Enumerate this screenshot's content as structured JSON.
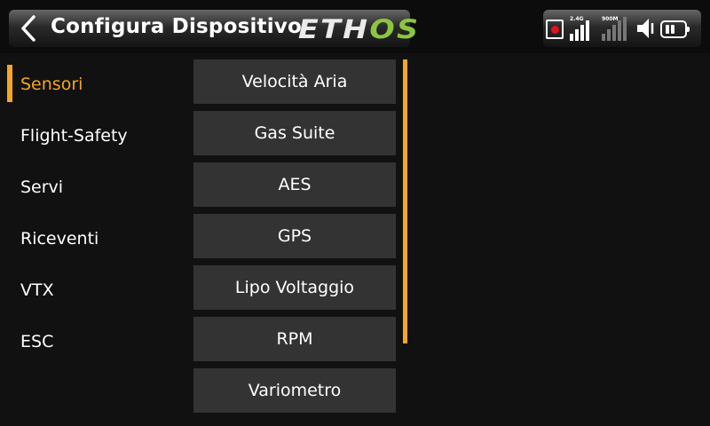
{
  "header": {
    "title": "Configura Dispositivo",
    "logo_main": "ETH",
    "logo_accent": "OS",
    "logo_accent_color": "#8cc63f",
    "back_icon": "chevron-left-icon"
  },
  "status": {
    "band_1_label": "2.4G",
    "band_2_label": "900M",
    "record_icon": "record-icon",
    "speaker_icon": "speaker-icon",
    "battery_icon": "battery-icon"
  },
  "sidebar": {
    "accent_color": "#f5a623",
    "items": [
      {
        "label": "Sensori",
        "active": true
      },
      {
        "label": "Flight-Safety",
        "active": false
      },
      {
        "label": "Servi",
        "active": false
      },
      {
        "label": "Riceventi",
        "active": false
      },
      {
        "label": "VTX",
        "active": false
      },
      {
        "label": "ESC",
        "active": false
      }
    ]
  },
  "options": {
    "items": [
      {
        "label": "Velocità Aria"
      },
      {
        "label": "Gas Suite"
      },
      {
        "label": "AES"
      },
      {
        "label": "GPS"
      },
      {
        "label": "Lipo Voltaggio"
      },
      {
        "label": "RPM"
      },
      {
        "label": "Variometro"
      }
    ]
  }
}
